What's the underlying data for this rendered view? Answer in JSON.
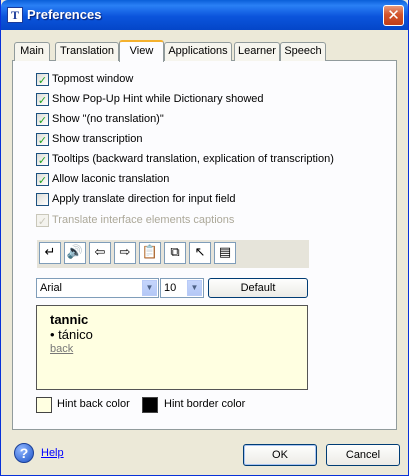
{
  "window": {
    "title": "Preferences",
    "icon_letter": "T",
    "close_glyph": "✕"
  },
  "tabs": [
    {
      "label": "Main"
    },
    {
      "label": "Translation"
    },
    {
      "label": "View",
      "active": true
    },
    {
      "label": "Applications"
    },
    {
      "label": "Learner"
    },
    {
      "label": "Speech"
    }
  ],
  "options": [
    {
      "label": "Topmost window",
      "checked": true,
      "enabled": true
    },
    {
      "label": "Show Pop-Up Hint while Dictionary showed",
      "checked": true,
      "enabled": true
    },
    {
      "label": "Show \"(no translation)\"",
      "checked": true,
      "enabled": true
    },
    {
      "label": "Show transcription",
      "checked": true,
      "enabled": true
    },
    {
      "label": "Tooltips (backward translation, explication of transcription)",
      "checked": true,
      "enabled": true
    },
    {
      "label": "Allow laconic translation",
      "checked": true,
      "enabled": true
    },
    {
      "label": "Apply translate direction for input field",
      "checked": false,
      "enabled": true
    },
    {
      "label": "Translate interface elements captions",
      "checked": true,
      "enabled": false
    }
  ],
  "toolbar": {
    "buttons": [
      {
        "icon": "enter-icon",
        "glyph": "↵"
      },
      {
        "icon": "speaker-icon",
        "glyph": "🔊"
      },
      {
        "icon": "arrow-left-icon",
        "glyph": "⇦"
      },
      {
        "icon": "arrow-right-icon",
        "glyph": "⇨"
      },
      {
        "icon": "paste-icon",
        "glyph": "📋"
      },
      {
        "icon": "copy-icon",
        "glyph": "⧉"
      },
      {
        "icon": "cursor-icon",
        "glyph": "↖"
      },
      {
        "icon": "dictionary-icon",
        "glyph": "▤"
      }
    ]
  },
  "font": {
    "family": "Arial",
    "size": "10",
    "default_label": "Default"
  },
  "preview": {
    "word": "tannic",
    "translation": "• tánico",
    "back": "back"
  },
  "colors": {
    "hint_back_label": "Hint back color",
    "hint_back_color": "#ffffe1",
    "hint_border_label": "Hint border color",
    "hint_border_color": "#000000"
  },
  "footer": {
    "help_label": "Help",
    "ok_label": "OK",
    "cancel_label": "Cancel"
  }
}
